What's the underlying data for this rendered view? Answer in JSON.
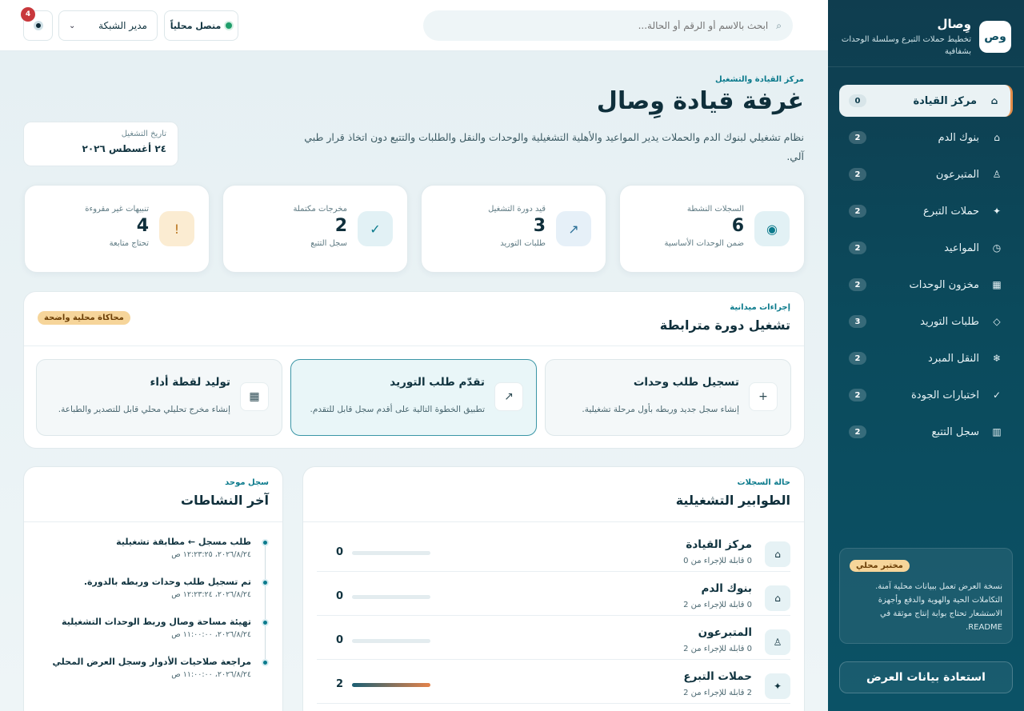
{
  "brand": {
    "logo": "وص",
    "name": "وِصال",
    "tagline": "تخطيط حملات التبرع وسلسلة الوحدات بشفافية"
  },
  "sidebar": {
    "items": [
      {
        "label": "مركز القيادة",
        "count": "0",
        "icon": "⌂",
        "active": true
      },
      {
        "label": "بنوك الدم",
        "count": "2",
        "icon": "⌂"
      },
      {
        "label": "المتبرعون",
        "count": "2",
        "icon": "♙"
      },
      {
        "label": "حملات التبرع",
        "count": "2",
        "icon": "✦"
      },
      {
        "label": "المواعيد",
        "count": "2",
        "icon": "◷"
      },
      {
        "label": "مخزون الوحدات",
        "count": "2",
        "icon": "▦"
      },
      {
        "label": "طلبات التوريد",
        "count": "3",
        "icon": "◇"
      },
      {
        "label": "النقل المبرد",
        "count": "2",
        "icon": "❄"
      },
      {
        "label": "اختبارات الجودة",
        "count": "2",
        "icon": "✓"
      },
      {
        "label": "سجل التتبع",
        "count": "2",
        "icon": "▥"
      }
    ],
    "lab": {
      "badge": "مختبر محلي",
      "text": "نسخة العرض تعمل ببيانات محلية آمنة. التكاملات الحية والهوية والدفع وأجهزة الاستشعار تحتاج بوابة إنتاج موثقة في README."
    },
    "restore_label": "استعادة بيانات العرض"
  },
  "topbar": {
    "search_placeholder": "ابحث بالاسم أو الرقم أو الحالة...",
    "status_label": "متصل محلياً",
    "role_value": "مدير الشبكة",
    "notifications_count": "4"
  },
  "hero": {
    "eyebrow": "مركز القيادة والتشغيل",
    "title": "غرفة قيادة وِصال",
    "description": "نظام تشغيلي لبنوك الدم والحملات يدير المواعيد والأهلية التشغيلية والوحدات والنقل والطلبات والتتبع دون اتخاذ قرار طبي آلي.",
    "date_label": "تاريخ التشغيل",
    "date_value": "٢٤ أغسطس ٢٠٢٦"
  },
  "stats": [
    {
      "label": "السجلات النشطة",
      "value": "6",
      "note": "ضمن الوحدات الأساسية",
      "icon": "◉",
      "icon_bg": "#e2f1f5",
      "icon_color": "#0b7a8c"
    },
    {
      "label": "قيد دورة التشغيل",
      "value": "3",
      "note": "طلبات التوريد",
      "icon": "↗",
      "icon_bg": "#e6f0f8",
      "icon_color": "#2a6f96"
    },
    {
      "label": "مخرجات مكتملة",
      "value": "2",
      "note": "سجل التتبع",
      "icon": "✓",
      "icon_bg": "#e2f1f5",
      "icon_color": "#0b7a8c"
    },
    {
      "label": "تنبيهات غير مقروءة",
      "value": "4",
      "note": "تحتاج متابعة",
      "icon": "!",
      "icon_bg": "#fbecd2",
      "icon_color": "#b8731c"
    }
  ],
  "cycle": {
    "eyebrow": "إجراءات ميدانية",
    "title": "تشغيل دورة مترابطة",
    "badge": "محاكاة محلية واضحة",
    "actions": [
      {
        "title": "تسجيل طلب وحدات",
        "desc": "إنشاء سجل جديد وربطه بأول مرحلة تشغيلية.",
        "icon": "+"
      },
      {
        "title": "تقدّم طلب التوريد",
        "desc": "تطبيق الخطوة التالية على أقدم سجل قابل للتقدم.",
        "icon": "↗"
      },
      {
        "title": "توليد لقطة أداء",
        "desc": "إنشاء مخرج تحليلي محلي قابل للتصدير والطباعة.",
        "icon": "▦"
      }
    ]
  },
  "queues": {
    "eyebrow": "حالة السجلات",
    "title": "الطوابير التشغيلية",
    "rows": [
      {
        "name": "مركز القيادة",
        "sub": "0 قابلة للإجراء من 0",
        "value": "0",
        "fill": 0,
        "icon": "⌂"
      },
      {
        "name": "بنوك الدم",
        "sub": "0 قابلة للإجراء من 2",
        "value": "0",
        "fill": 0,
        "icon": "⌂"
      },
      {
        "name": "المتبرعون",
        "sub": "0 قابلة للإجراء من 2",
        "value": "0",
        "fill": 0,
        "icon": "♙"
      },
      {
        "name": "حملات التبرع",
        "sub": "2 قابلة للإجراء من 2",
        "value": "2",
        "fill": 1,
        "icon": "✦"
      }
    ]
  },
  "activity": {
    "eyebrow": "سجل موحد",
    "title": "آخر النشاطات",
    "items": [
      {
        "title": "طلب مسجل ← مطابقة تشغيلية",
        "time": "٢٠٢٦/٨/٢٤، ١٢:٢٣:٢٥ ص"
      },
      {
        "title": "تم تسجيل طلب وحدات وربطه بالدورة.",
        "time": "٢٠٢٦/٨/٢٤، ١٢:٢٣:٢٤ ص"
      },
      {
        "title": "تهيئة مساحة وصال وربط الوحدات التشغيلية",
        "time": "٢٠٢٦/٨/٢٤، ١١:٠٠:٠٠ ص"
      },
      {
        "title": "مراجعة صلاحيات الأدوار وسجل العرض المحلي",
        "time": "٢٠٢٦/٨/٢٤، ١١:٠٠:٠٠ ص"
      }
    ]
  }
}
